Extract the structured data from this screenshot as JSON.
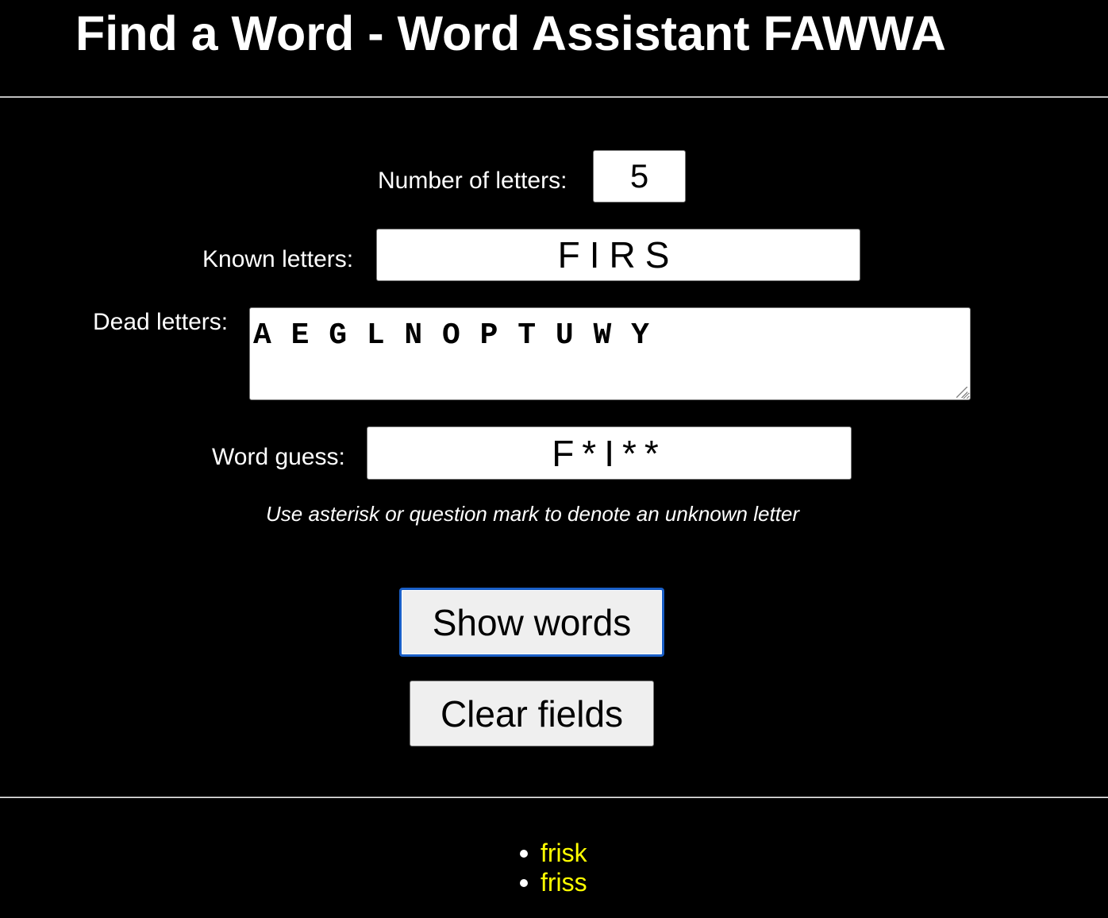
{
  "header": {
    "title": "Find a Word - Word Assistant FAWWA"
  },
  "form": {
    "letters_count_label": "Number of letters:",
    "letters_count_value": "5",
    "known_letters_label": "Known letters:",
    "known_letters_value": "FIRS",
    "dead_letters_label": "Dead letters:",
    "dead_letters_value": "A E G L N O P T U W Y",
    "word_guess_label": "Word guess:",
    "word_guess_value": "F*I**",
    "hint": "Use asterisk or question mark to denote an unknown letter"
  },
  "buttons": {
    "show_words_label": "Show words",
    "clear_fields_label": "Clear fields"
  },
  "results": {
    "items": [
      "frisk",
      "friss"
    ]
  },
  "colors": {
    "background": "#000000",
    "text": "#ffffff",
    "result_text": "#ffff00",
    "focus_border": "#1a5fc7"
  }
}
